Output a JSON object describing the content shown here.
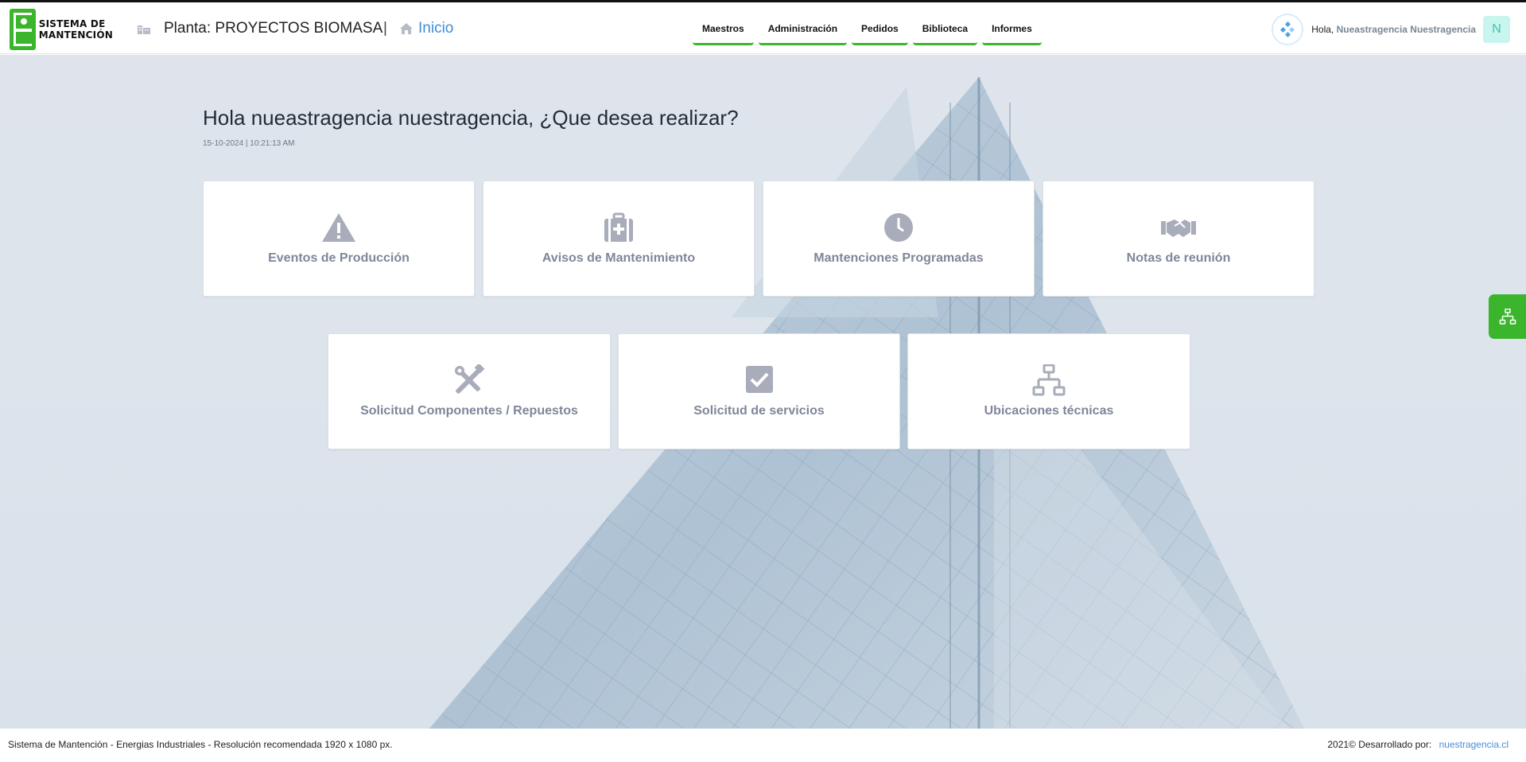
{
  "header": {
    "logo_line1": "SISTEMA DE",
    "logo_line2": "MANTENCIÓN",
    "plant_label": "Planta: PROYECTOS BIOMASA",
    "separator": "|",
    "home_label": "Inicio",
    "nav": [
      "Maestros",
      "Administración",
      "Pedidos",
      "Biblioteca",
      "Informes"
    ],
    "greeting": "Hola,",
    "user_name": "Nueastragencia Nuestragencia",
    "avatar_letter": "N"
  },
  "main": {
    "welcome": "Hola nueastragencia nuestragencia, ¿Que desea realizar?",
    "datetime": "15-10-2024 | 10:21:13 AM",
    "cards_row1": [
      {
        "label": "Eventos de Producción",
        "icon": "warning-icon"
      },
      {
        "label": "Avisos de Mantenimiento",
        "icon": "medical-kit-icon"
      },
      {
        "label": "Mantenciones Programadas",
        "icon": "clock-icon"
      },
      {
        "label": "Notas de reunión",
        "icon": "handshake-icon"
      }
    ],
    "cards_row2": [
      {
        "label": "Solicitud Componentes / Repuestos",
        "icon": "tools-icon"
      },
      {
        "label": "Solicitud de servicios",
        "icon": "check-square-icon"
      },
      {
        "label": "Ubicaciones técnicas",
        "icon": "sitemap-icon"
      }
    ]
  },
  "footer": {
    "left": "Sistema de Mantención - Energias Industriales - Resolución recomendada 1920 x 1080 px.",
    "right": "2021© Desarrollado por:",
    "developer": "nuestragencia.cl"
  },
  "colors": {
    "accent_green": "#3bb62c",
    "link_blue": "#3b8fd6",
    "card_text": "#7f8699",
    "icon_gray": "#a9acba"
  }
}
